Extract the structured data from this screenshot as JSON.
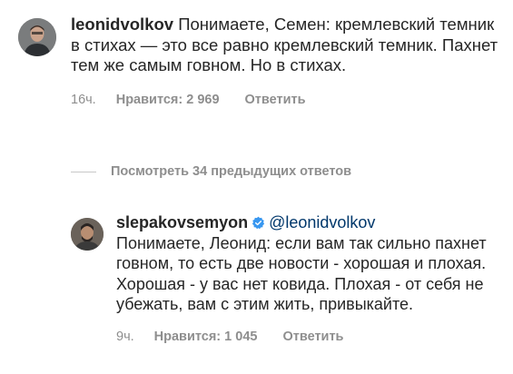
{
  "comments": [
    {
      "username": "leonidvolkov",
      "text": "Понимаете, Семен: кремлевский темник в стихах — это все равно кремлевский темник. Пахнет тем же самым говном. Но в стихах.",
      "time": "16ч.",
      "likes": "Нравится: 2 969",
      "reply": "Ответить"
    },
    {
      "username": "slepakovsemyon",
      "verified": true,
      "mention": "@leonidvolkov",
      "text": "Понимаете, Леонид: если вам так сильно пахнет говном, то есть две новости - хорошая и плохая. Хорошая - у вас нет ковида. Плохая - от себя не убежать, вам с этим жить, привыкайте.",
      "time": "9ч.",
      "likes": "Нравится: 1 045",
      "reply": "Ответить"
    }
  ],
  "view_replies": "Посмотреть 34 предыдущих ответов",
  "colors": {
    "text": "#262626",
    "secondary": "#8e8e8e",
    "verified": "#3897f0",
    "mention": "#00376b"
  },
  "icons": [
    "avatar",
    "verified-badge-icon"
  ]
}
